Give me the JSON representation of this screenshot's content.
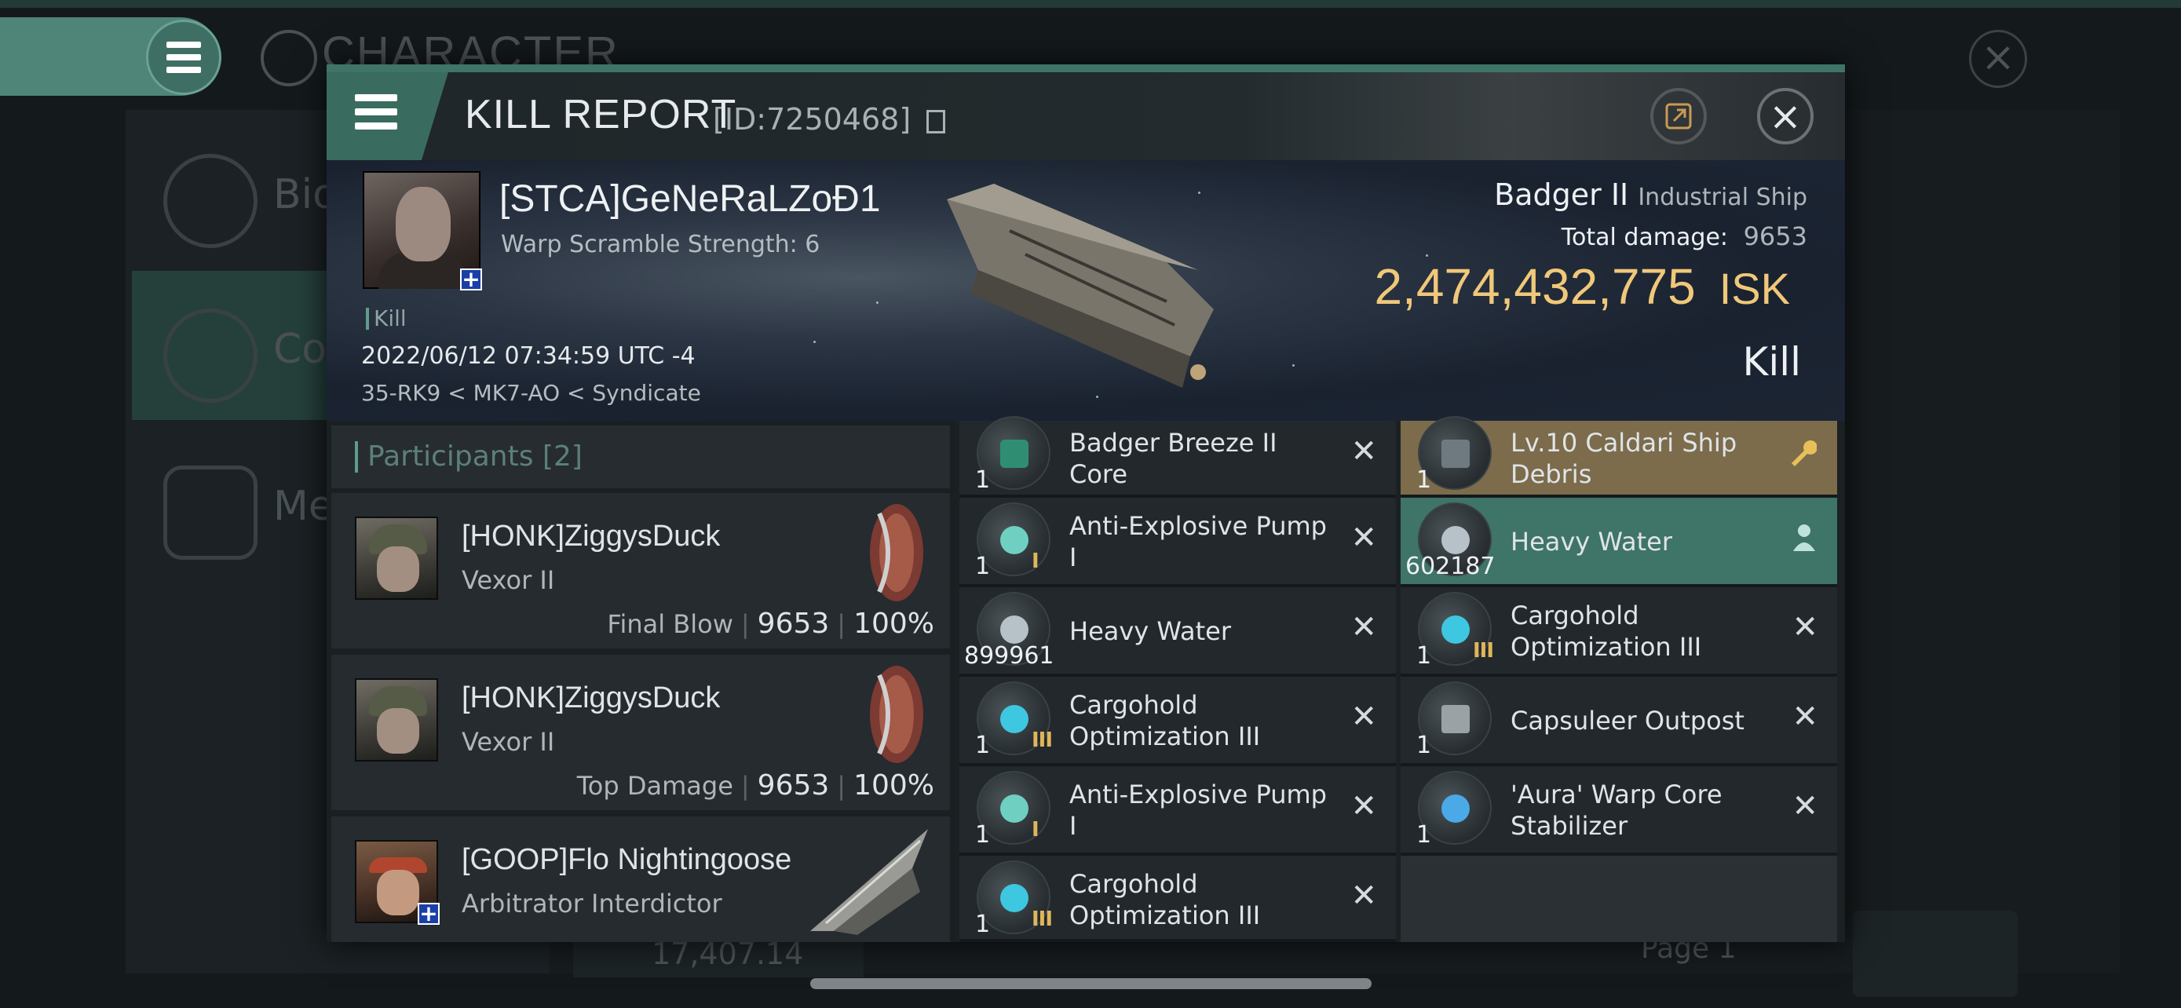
{
  "background": {
    "title": "CHARACTER",
    "sidebar": [
      {
        "label": "Bio"
      },
      {
        "label": "Co"
      },
      {
        "label": "Me"
      }
    ],
    "bottom_value": "17,407.14",
    "page_label": "Page 1"
  },
  "dialog": {
    "title": "KILL REPORT",
    "id_label": "[ID:7250468]"
  },
  "victim": {
    "name": "[STCA]GeNeRaLZoĐ1",
    "warp_scramble": "Warp Scramble Strength: 6",
    "kill_tag": "Kill",
    "datetime": "2022/06/12 07:34:59 UTC -4",
    "location": "35-RK9 < MK7-AO < Syndicate",
    "ship_name": "Badger II",
    "ship_class": "Industrial Ship",
    "total_damage_label": "Total damage:",
    "total_damage": "9653",
    "isk_value": "2,474,432,775",
    "isk_unit": "ISK",
    "kill_type": "Kill"
  },
  "participants": {
    "title": "Participants",
    "count": "[2]",
    "rows": [
      {
        "name": "[HONK]ZiggysDuck",
        "ship": "Vexor II",
        "stat_label": "Final Blow",
        "damage": "9653",
        "percent": "100%"
      },
      {
        "name": "[HONK]ZiggysDuck",
        "ship": "Vexor II",
        "stat_label": "Top Damage",
        "damage": "9653",
        "percent": "100%"
      },
      {
        "name": "[GOOP]Flo Nightingoose",
        "ship": "Arbitrator Interdictor",
        "stat_label": "",
        "damage": "",
        "percent": ""
      }
    ]
  },
  "items_col1": [
    {
      "qty": "1",
      "name": "Badger Breeze II Core",
      "tech": "",
      "icon": "core-icon",
      "status": "destroyed"
    },
    {
      "qty": "1",
      "name": "Anti-Explosive Pump I",
      "tech": "I",
      "icon": "pump-icon",
      "status": "destroyed"
    },
    {
      "qty": "899961",
      "name": "Heavy Water",
      "tech": "",
      "icon": "heavy-water-icon",
      "status": "destroyed"
    },
    {
      "qty": "1",
      "name": "Cargohold Optimization III",
      "tech": "III",
      "icon": "cargohold-icon",
      "status": "destroyed"
    },
    {
      "qty": "1",
      "name": "Anti-Explosive Pump I",
      "tech": "I",
      "icon": "pump-icon",
      "status": "destroyed"
    },
    {
      "qty": "1",
      "name": "Cargohold Optimization III",
      "tech": "III",
      "icon": "cargohold-icon",
      "status": "destroyed"
    }
  ],
  "items_col2": [
    {
      "qty": "1",
      "name": "Lv.10 Caldari Ship Debris",
      "tech": "",
      "icon": "debris-icon",
      "status": "salvage",
      "highlight": "#7c6c4c"
    },
    {
      "qty": "602187",
      "name": "Heavy Water",
      "tech": "",
      "icon": "heavy-water-icon",
      "status": "dropped",
      "highlight": "#3f7468"
    },
    {
      "qty": "1",
      "name": "Cargohold Optimization III",
      "tech": "III",
      "icon": "cargohold-icon",
      "status": "destroyed"
    },
    {
      "qty": "1",
      "name": "Capsuleer Outpost",
      "tech": "",
      "icon": "outpost-icon",
      "status": "destroyed"
    },
    {
      "qty": "1",
      "name": "'Aura' Warp Core Stabilizer",
      "tech": "",
      "icon": "stabilizer-icon",
      "status": "destroyed"
    }
  ],
  "colors": {
    "accent": "#3f7468",
    "isk": "#f0c87a",
    "salvage_row": "#7c6c4c",
    "dropped_row": "#3f7468"
  }
}
